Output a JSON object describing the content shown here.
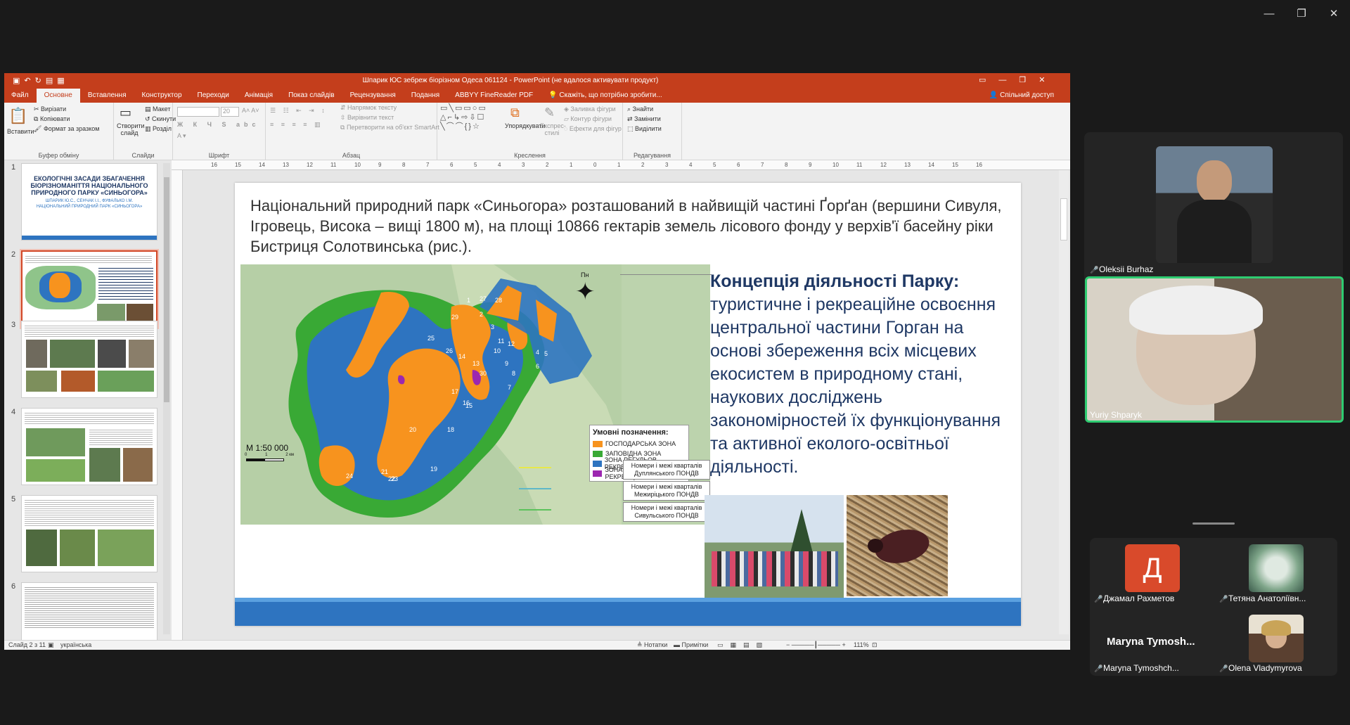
{
  "zoom_window": {
    "controls": [
      "—",
      "❐",
      "✕"
    ]
  },
  "ppt": {
    "window_title": "Шпарик ЮС зебреж біорізном Одеса 061124 - PowerPoint (не вдалося активувати продукт)",
    "share_label": "Спільний доступ",
    "tabs": [
      "Файл",
      "Основне",
      "Вставлення",
      "Конструктор",
      "Переходи",
      "Анімація",
      "Показ слайдів",
      "Рецензування",
      "Подання",
      "ABBYY FineReader PDF"
    ],
    "tell_me": "Скажіть, що потрібно зробити...",
    "ribbon": {
      "paste": "Вставити",
      "cut": "Вирізати",
      "copy": "Копіювати",
      "format_painter": "Формат за зразком",
      "clipboard_group": "Буфер обміну",
      "new_slide": "Створити слайд",
      "layout": "Макет",
      "reset": "Скинути",
      "sections": "Розділ",
      "slides_group": "Слайди",
      "font_size": "20",
      "font_group": "Шрифт",
      "text_direction": "Напрямок тексту",
      "align_text": "Вирівнити текст",
      "convert_smartart": "Перетворити на об'єкт SmartArt",
      "paragraph_group": "Абзац",
      "arrange": "Упорядкувати",
      "quick_styles": "Експрес-стилі",
      "shape_fill": "Заливка фігури",
      "shape_outline": "Контур фігури",
      "shape_effects": "Ефекти для фігур",
      "drawing_group": "Креслення",
      "find": "Знайти",
      "replace": "Замінити",
      "select": "Виділити",
      "editing_group": "Редагування"
    },
    "ruler_ticks": [
      "16",
      "15",
      "14",
      "13",
      "12",
      "11",
      "10",
      "9",
      "8",
      "7",
      "6",
      "5",
      "4",
      "3",
      "2",
      "1",
      "0",
      "1",
      "2",
      "3",
      "4",
      "5",
      "6",
      "7",
      "8",
      "9",
      "10",
      "11",
      "12",
      "13",
      "14",
      "15",
      "16"
    ],
    "thumbnails": [
      {
        "num": "1",
        "title": "ЕКОЛОГІЧНІ ЗАСАДИ ЗБАГАЧЕННЯ БІОРІЗНОМАНІТТЯ НАЦІОНАЛЬНОГО ПРИРОДНОГО ПАРКУ «СИНЬОГОРА»",
        "authors": "ШПАРИК Ю.С., СЕНЧАК І.І., ФУФАЛЬКО І.М.",
        "org": "НАЦІОНАЛЬНИЙ ПРИРОДНИЙ ПАРК «СИНЬОГОРА»"
      },
      {
        "num": "2"
      },
      {
        "num": "3"
      },
      {
        "num": "4"
      },
      {
        "num": "5"
      },
      {
        "num": "6"
      }
    ],
    "slide": {
      "intro": "Національний природний парк «Синьогора» розташований в найвищій частині Ґорґан (вершини Сивуля, Ігровець, Висока – вищі 1800 м), на площі 10866 гектарів земель лісового фонду у верхів'ї басейну ріки Бистриця Солотвинська (рис.).",
      "concept_title": "Концепція діяльності Парку:",
      "concept_body": "туристичне і рекреаційне освоєння центральної частини Горган на основі збереження всіх місцевих екосистем в природному стані, наукових досліджень закономірностей їх функціонування та активної еколого-освітньої діяльності.",
      "map": {
        "north": "Пн",
        "scale": "М 1:50 000",
        "scale_ticks": [
          "0",
          "1",
          "2 км"
        ],
        "legend_title": "Умовні позначення:",
        "legend": [
          {
            "label": "ГОСПОДАРСЬКА ЗОНА",
            "color": "#f7931e"
          },
          {
            "label": "ЗАПОВІДНА ЗОНА",
            "color": "#39a935"
          },
          {
            "label": "ЗОНА РЕГУЛЬОВ. РЕКРЕАЦІЇ",
            "color": "#2e74c0"
          },
          {
            "label": "ЗОНА СТАЦІОН. РЕКРЕАЦІЇ",
            "color": "#9c27b0"
          }
        ],
        "quarters": [
          {
            "label": "Номери і межі кварталів Дуплянського ПОНДВ",
            "color": "#e8e84a"
          },
          {
            "label": "Номери і межі кварталів Межиріцького ПОНДВ",
            "color": "#5fb8c8"
          },
          {
            "label": "Номери і межі кварталів Сивульського ПОНДВ",
            "color": "#5cc25c"
          }
        ],
        "numbers": [
          "1",
          "2",
          "3",
          "4",
          "5",
          "6",
          "7",
          "8",
          "9",
          "10",
          "11",
          "12",
          "13",
          "14",
          "15",
          "16",
          "17",
          "18",
          "19",
          "20",
          "21",
          "22",
          "23",
          "24",
          "25",
          "26",
          "27",
          "28",
          "29",
          "30"
        ]
      }
    },
    "status": {
      "slide_of": "Слайд 2 з 11",
      "language": "українська",
      "notes": "Нотатки",
      "comments": "Примітки",
      "zoom": "111%"
    }
  },
  "participants": [
    {
      "name": "Oleksii Burhaz"
    },
    {
      "name": "Yuriy Shparyk"
    },
    {
      "name": "Джамал Рахметов",
      "initial": "Д",
      "avatar_color": "#d94a2b"
    },
    {
      "name": "Тетяна Анатоліївн..."
    },
    {
      "name": "Maryna Tymoshch...",
      "display": "Maryna Tymosh..."
    },
    {
      "name": "Olena Vladymyrova"
    }
  ]
}
